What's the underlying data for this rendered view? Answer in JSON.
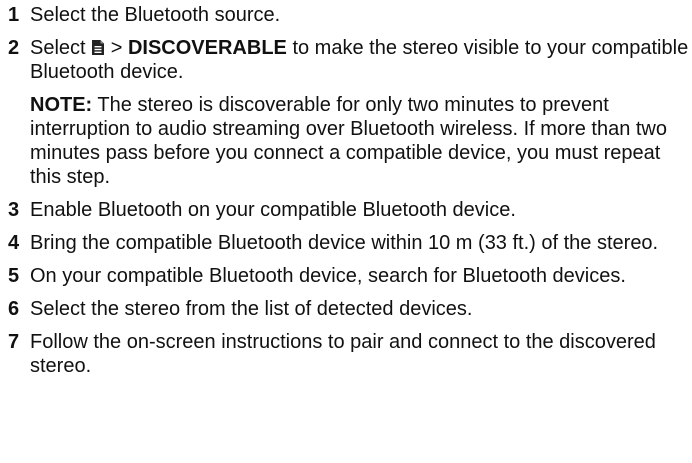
{
  "steps": [
    {
      "number": "1",
      "text": "Select the Bluetooth source."
    },
    {
      "number": "2",
      "prefix": "Select",
      "icon": "menu-icon",
      "separator": ">",
      "option": "DISCOVERABLE",
      "suffix": "to make the stereo visible to your compatible Bluetooth device.",
      "note_label": "NOTE:",
      "note_text": "The stereo is discoverable for only two minutes to prevent interruption to audio streaming over Bluetooth wireless. If more than two minutes pass before you connect a compatible device, you must repeat this step."
    },
    {
      "number": "3",
      "text": "Enable Bluetooth on your compatible Bluetooth device."
    },
    {
      "number": "4",
      "text": "Bring the compatible Bluetooth device within 10 m (33 ft.) of the stereo."
    },
    {
      "number": "5",
      "text": "On your compatible Bluetooth device, search for Bluetooth devices."
    },
    {
      "number": "6",
      "text": "Select the stereo from the list of detected devices."
    },
    {
      "number": "7",
      "text": "Follow the on-screen instructions to pair and connect to the discovered stereo."
    }
  ]
}
